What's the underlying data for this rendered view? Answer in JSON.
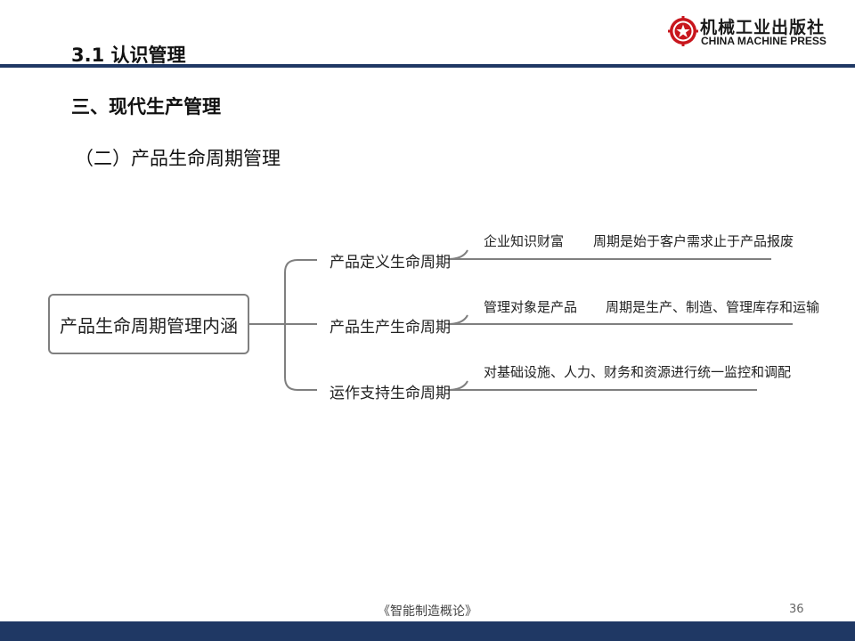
{
  "header": {
    "title": "3.1 认识管理"
  },
  "logo": {
    "name_cn": "机械工业出版社",
    "name_en": "CHINA MACHINE PRESS",
    "icon": "star-gear-seal-icon"
  },
  "section_title": "三、现代生产管理",
  "sub_title": "（二）产品生命周期管理",
  "diagram": {
    "root": "产品生命周期管理内涵",
    "branches": [
      {
        "label": "产品定义生命周期",
        "leaves": [
          "企业知识财富",
          "周期是始于客户需求止于产品报废"
        ]
      },
      {
        "label": "产品生产生命周期",
        "leaves": [
          "管理对象是产品",
          "周期是生产、制造、管理库存和运输"
        ]
      },
      {
        "label": "运作支持生命周期",
        "leaves": [
          "对基础设施、人力、财务和资源进行统一监控和调配"
        ]
      }
    ]
  },
  "footer": {
    "book_title": "《智能制造概论》",
    "page_number": "36"
  },
  "colors": {
    "accent_bar": "#1f3864",
    "connector": "#7f7f7f",
    "logo_red": "#c8161d"
  }
}
